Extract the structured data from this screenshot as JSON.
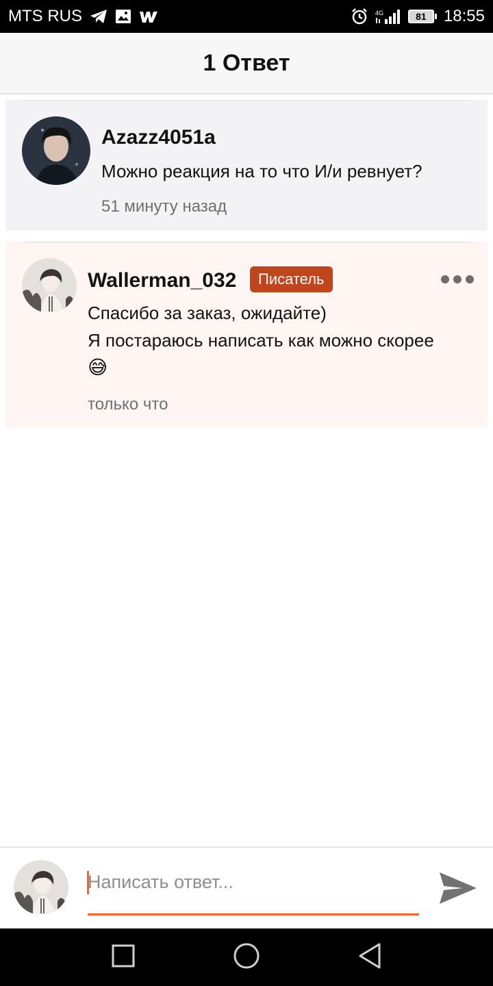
{
  "status_bar": {
    "carrier": "MTS RUS",
    "network": "4G",
    "battery": "81",
    "time": "18:55"
  },
  "header": {
    "title": "1 Ответ"
  },
  "parent_comment": {
    "username": "Azazz4051a",
    "text": "Можно реакция на то что И/и ревнует?",
    "timestamp": "51 минуту назад"
  },
  "reply_comment": {
    "username": "Wallerman_032",
    "badge": "Писатель",
    "text_line1": "Спасибо за заказ, ожидайте)",
    "text_line2": "Я постараюсь написать как можно скорее",
    "emoji": "😅",
    "timestamp": "только что"
  },
  "composer": {
    "placeholder": "Написать ответ..."
  },
  "colors": {
    "accent": "#ff6122",
    "badge": "#c0451b",
    "reply_bg": "#fff5f2",
    "parent_bg": "#f3f3f5"
  },
  "icons": {
    "status": [
      "telegram-icon",
      "gallery-icon",
      "wattpad-icon",
      "alarm-icon",
      "signal-icon",
      "battery-icon"
    ],
    "composer": [
      "send-icon"
    ],
    "nav": [
      "recents-square-icon",
      "home-circle-icon",
      "back-triangle-icon"
    ]
  }
}
